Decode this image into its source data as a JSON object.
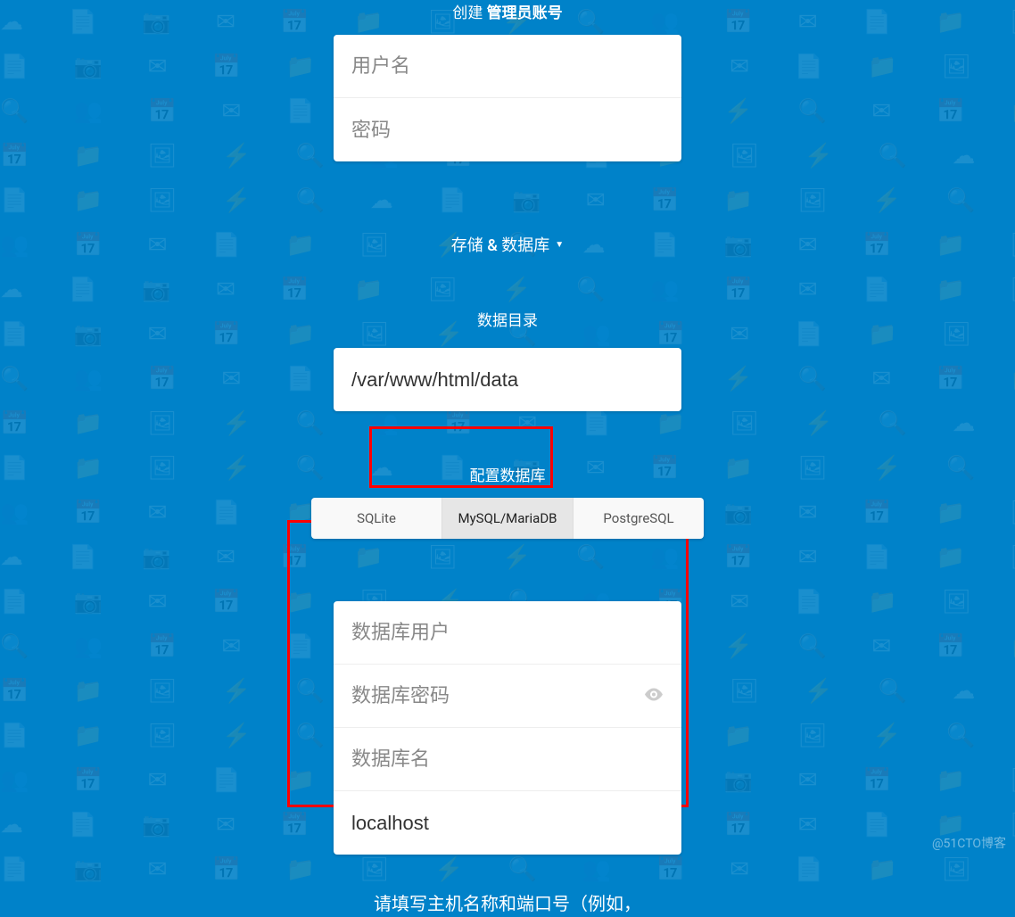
{
  "admin": {
    "title_prefix": "创建",
    "title_bold": "管理员账号",
    "username_placeholder": "用户名",
    "password_placeholder": "密码"
  },
  "storage": {
    "toggle_label": "存储 & 数据库",
    "data_dir_label": "数据目录",
    "data_dir_value": "/var/www/html/data",
    "db_config_label": "配置数据库"
  },
  "tabs": {
    "sqlite": "SQLite",
    "mysql": "MySQL/MariaDB",
    "postgres": "PostgreSQL"
  },
  "db": {
    "user_placeholder": "数据库用户",
    "password_placeholder": "数据库密码",
    "name_placeholder": "数据库名",
    "host_value": "localhost"
  },
  "note": {
    "line1": "请填写主机名称和端口号（例如，"
  },
  "watermark": "@51CTO博客"
}
